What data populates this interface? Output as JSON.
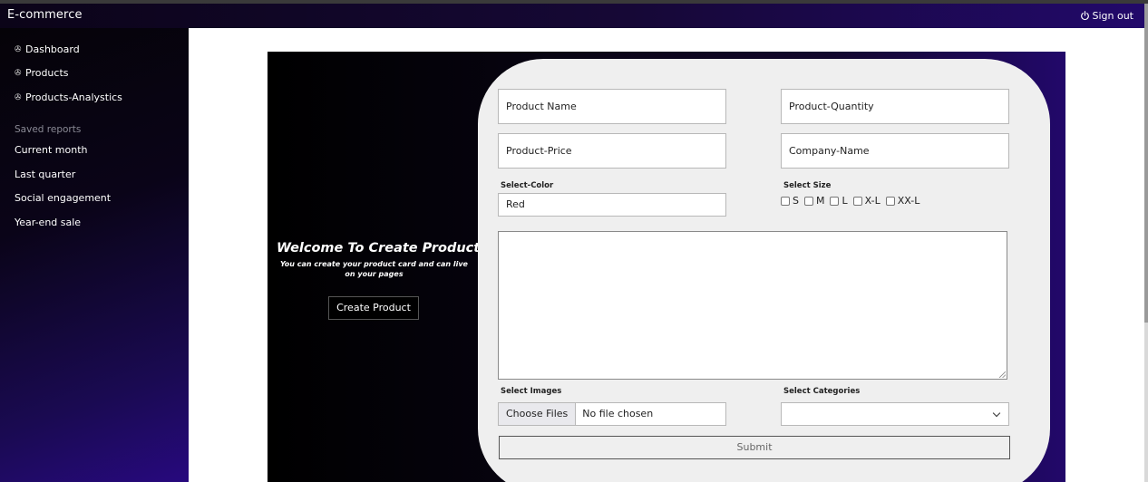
{
  "app": {
    "title": "E-commerce",
    "signout_label": "Sign out"
  },
  "sidebar": {
    "items": [
      {
        "label": "Dashboard",
        "icon": "gauge-icon"
      },
      {
        "label": "Products",
        "icon": "gauge-icon"
      },
      {
        "label": "Products-Analystics",
        "icon": "gauge-icon"
      }
    ],
    "saved_reports_heading": "Saved reports",
    "reports": [
      "Current month",
      "Last quarter",
      "Social engagement",
      "Year-end sale"
    ]
  },
  "welcome": {
    "title": "Welcome To Create Product",
    "subtitle": "You can create your product card and can live on your pages",
    "button_label": "Create Product"
  },
  "form": {
    "product_name_placeholder": "Product Name",
    "product_quantity_placeholder": "Product-Quantity",
    "product_price_placeholder": "Product-Price",
    "company_name_placeholder": "Company-Name",
    "color_label": "Select-Color",
    "color_value": "Red",
    "size_label": "Select Size",
    "sizes": [
      "S",
      "M",
      "L",
      "X-L",
      "XX-L"
    ],
    "images_label": "Select Images",
    "choose_files_label": "Choose Files",
    "no_file_text": "No file chosen",
    "categories_label": "Select Categories",
    "categories_value": "",
    "submit_label": "Submit"
  },
  "colors": {
    "topbar": "#160836",
    "sidebar_accent": "#27097e",
    "form_bg": "#efefef"
  }
}
